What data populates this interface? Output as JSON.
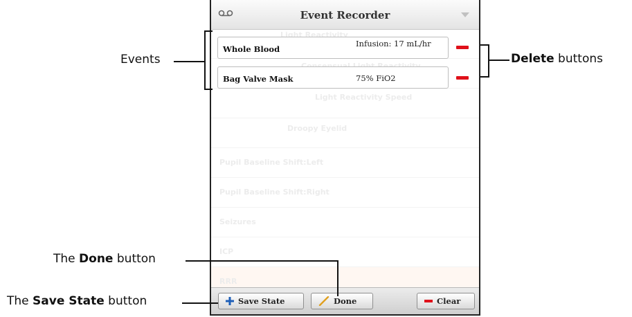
{
  "window": {
    "title": "Event Recorder",
    "voicemail_icon": "voicemail-icon",
    "menu_icon": "chevron-down-icon"
  },
  "background_items": [
    "Light Reactivity",
    "Consensual Light Reactivity",
    "Light Reactivity Speed",
    "Droopy Eyelid",
    "Pupil Baseline Shift:Left",
    "Pupil Baseline Shift:Right",
    "Seizures",
    "ICP",
    "RRR"
  ],
  "events": [
    {
      "name": "Whole Blood",
      "detail": "Infusion: 17 mL/hr"
    },
    {
      "name": "Bag Valve Mask",
      "detail": "75% FiO2"
    }
  ],
  "footer": {
    "save_state_label": "Save State",
    "done_label": "Done",
    "clear_label": "Clear"
  },
  "callouts": {
    "events": "Events",
    "delete_bold": "Delete",
    "delete_rest": " buttons",
    "done_prefix": "The ",
    "done_bold": "Done",
    "done_rest": " button",
    "save_prefix": "The ",
    "save_bold": "Save State",
    "save_rest": " button"
  },
  "colors": {
    "delete_red": "#e0101a",
    "save_plus_blue": "#1e5fb8",
    "done_pencil": "#e0a020"
  }
}
